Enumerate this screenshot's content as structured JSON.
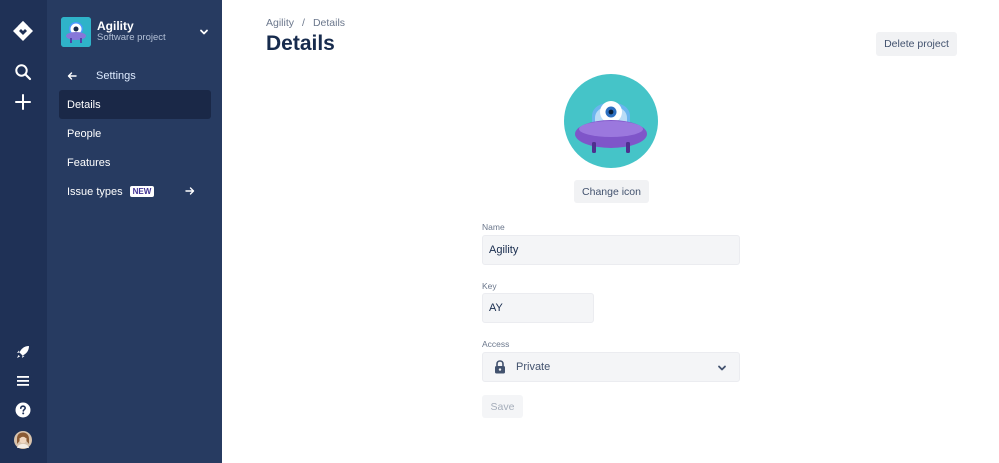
{
  "colors": {
    "global_nav_bg": "#1f3156",
    "sidebar_bg": "#273b61",
    "active_item_bg": "#1a2847",
    "icon_teal": "#2fb3c9",
    "icon_purple": "#6f4fc4"
  },
  "global_nav": {
    "icons": [
      "jira-logo-icon",
      "search-icon",
      "create-plus-icon",
      "rocket-icon",
      "menu-icon",
      "help-icon",
      "user-avatar"
    ]
  },
  "project": {
    "name": "Agility",
    "type": "Software project"
  },
  "sidebar": {
    "back_label": "Settings",
    "items": [
      {
        "label": "Details",
        "active": true
      },
      {
        "label": "People"
      },
      {
        "label": "Features"
      },
      {
        "label": "Issue types",
        "badge": "NEW"
      }
    ]
  },
  "breadcrumb": {
    "project": "Agility",
    "separator": "/",
    "current": "Details"
  },
  "page": {
    "title": "Details",
    "delete_button": "Delete project",
    "change_icon_button": "Change icon",
    "save_button": "Save"
  },
  "form": {
    "name": {
      "label": "Name",
      "value": "Agility"
    },
    "key": {
      "label": "Key",
      "value": "AY"
    },
    "access": {
      "label": "Access",
      "value": "Private"
    }
  }
}
